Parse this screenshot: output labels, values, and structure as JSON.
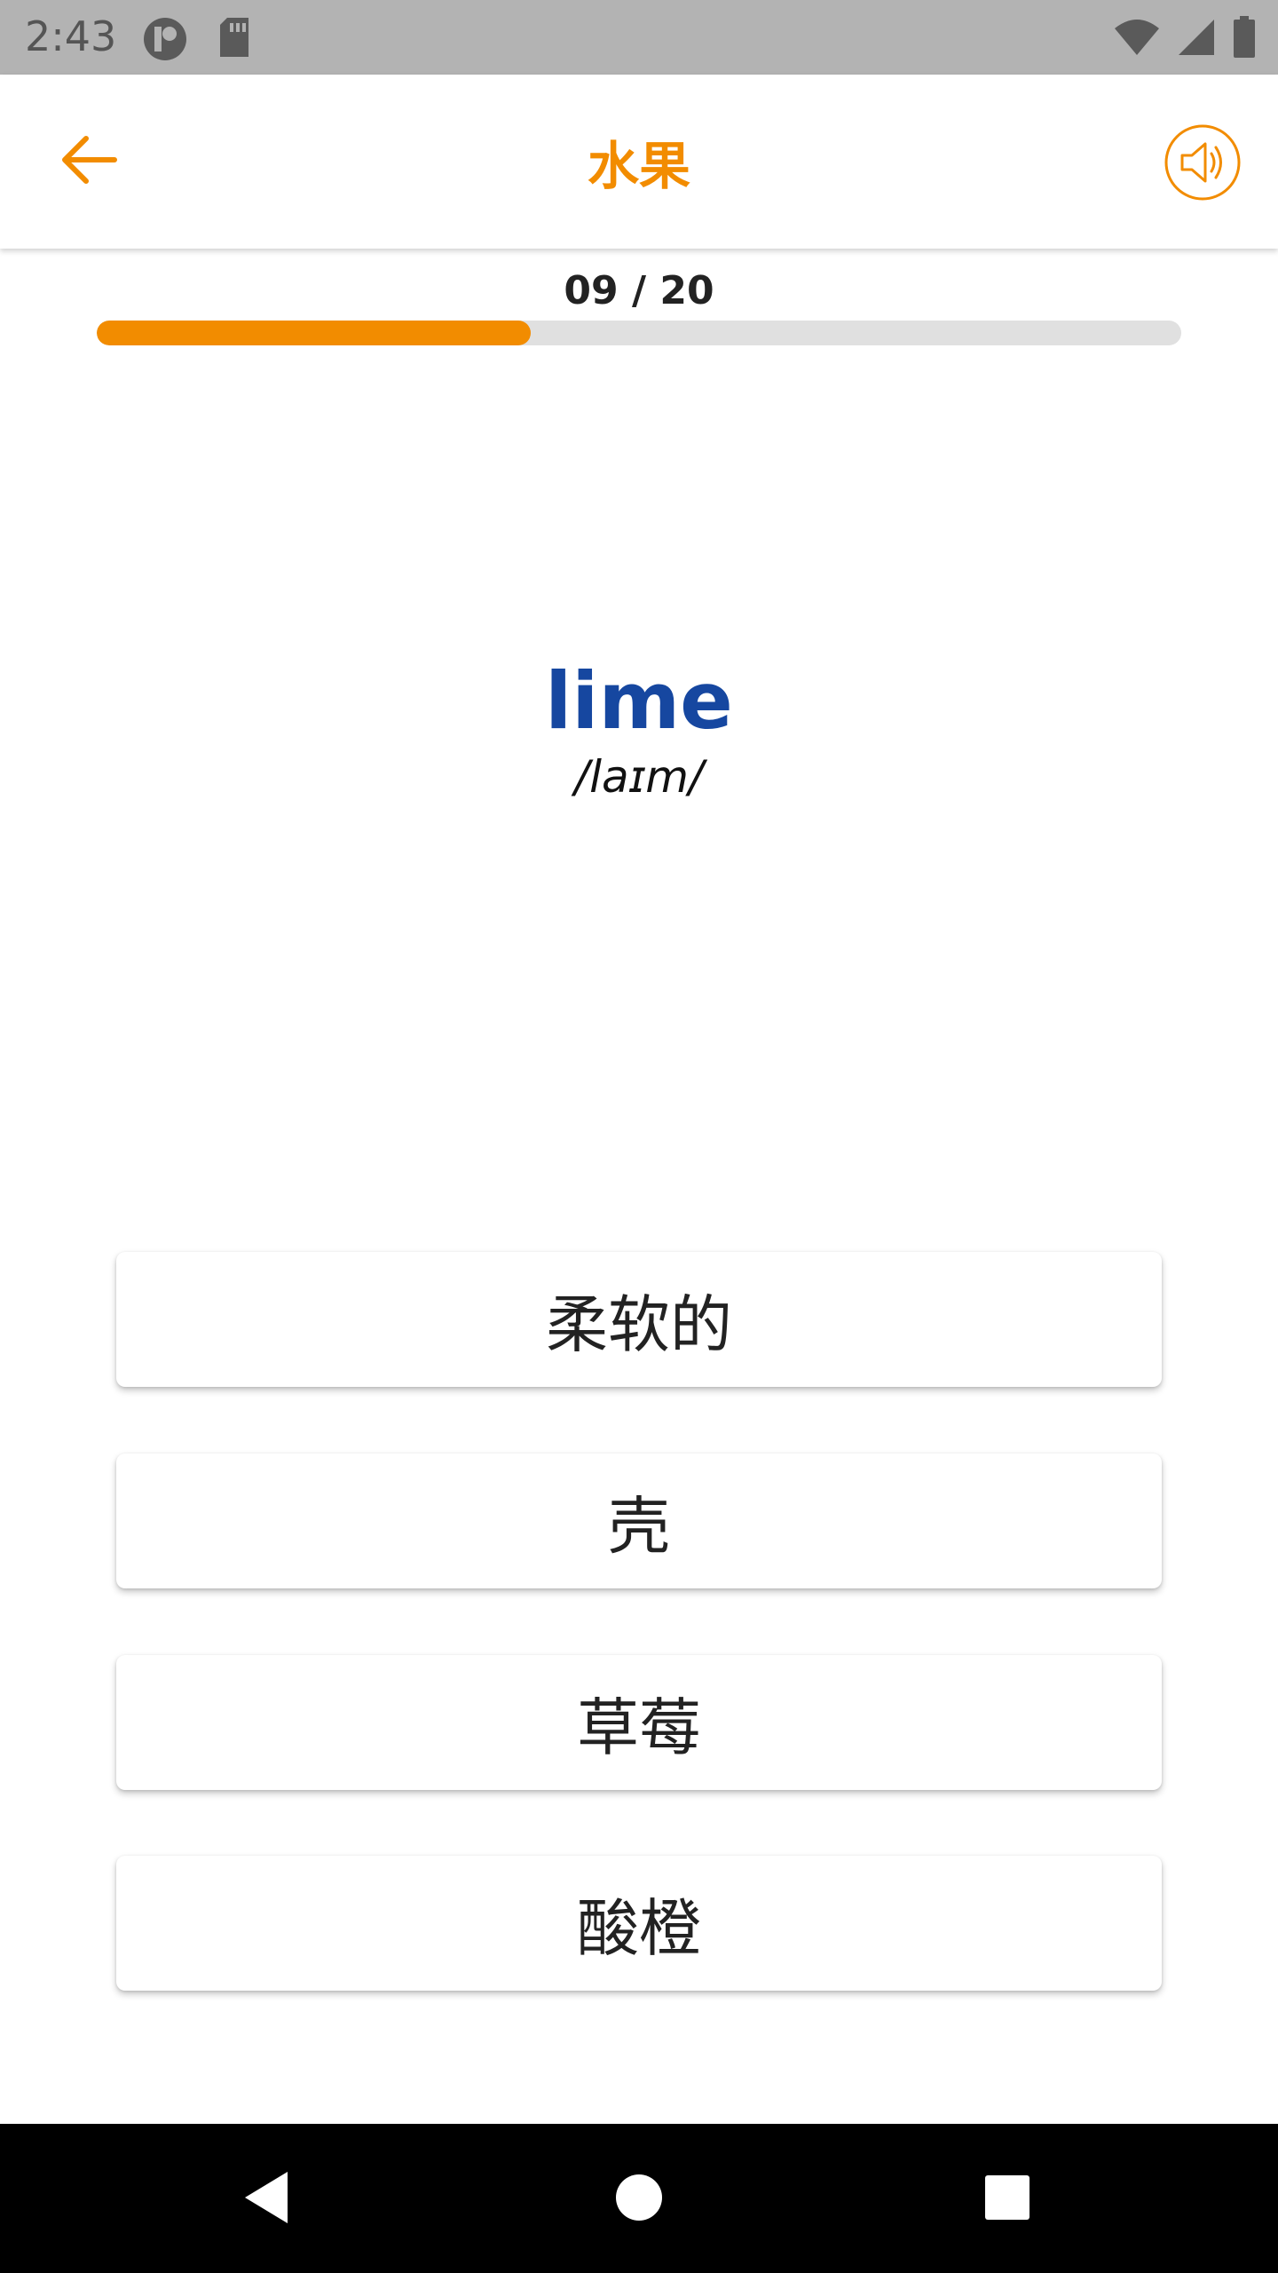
{
  "status_bar": {
    "time": "2:43",
    "left_icons": [
      "sync-icon",
      "sd-card-icon"
    ],
    "right_icons": [
      "wifi-icon",
      "cell-signal-icon",
      "battery-icon"
    ]
  },
  "app_bar": {
    "title": "水果",
    "back_icon": "arrow-left-icon",
    "speaker_icon": "speaker-icon"
  },
  "progress": {
    "label": "09 / 20",
    "current": 9,
    "total": 20,
    "fill_fraction": 0.4
  },
  "word": {
    "text": "lime",
    "phonetic": "/laɪm/"
  },
  "options": [
    {
      "label": "柔软的"
    },
    {
      "label": "壳"
    },
    {
      "label": "草莓"
    },
    {
      "label": "酸橙"
    }
  ],
  "nav_bar": {
    "buttons": [
      "back-triangle-icon",
      "home-circle-icon",
      "recents-square-icon"
    ]
  },
  "colors": {
    "accent": "#f28c00",
    "word": "#1647a0",
    "status_bar": "#b3b3b3",
    "nav_bar": "#000000",
    "progress_track": "#e0e0e0"
  }
}
